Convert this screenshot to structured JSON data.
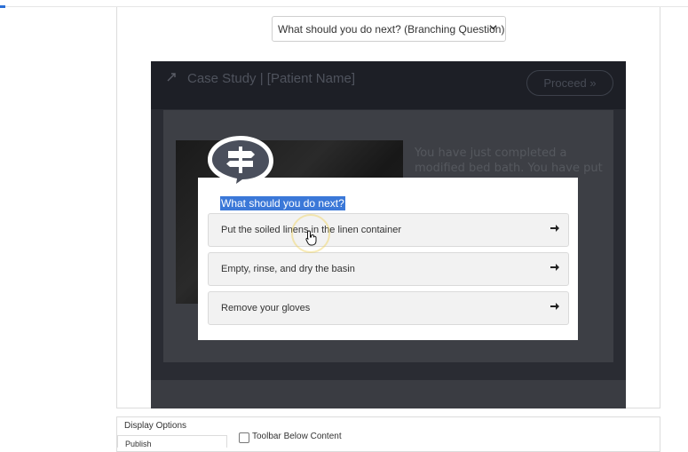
{
  "branching_select": {
    "value": "What should you do next? (Branching Question)"
  },
  "preview": {
    "title": "Case Study | [Patient Name]",
    "proceed_label": "Proceed »",
    "background_text": "You have just completed a modified bed bath.  You have put"
  },
  "question": {
    "prompt": "What should you do next?",
    "options": [
      {
        "label": "Put the soiled linens in the linen container"
      },
      {
        "label": "Empty, rinse, and dry the basin"
      },
      {
        "label": "Remove your gloves"
      }
    ]
  },
  "settings": {
    "display_options_label": "Display Options",
    "publish_label": "Publish",
    "toolbar_below_content_label": "Toolbar Below Content"
  },
  "icons": {
    "expand": "expand-icon",
    "signpost": "signpost-icon",
    "option_arrow": "arrow-right-icon",
    "select_chevron": "chevron-down-icon",
    "cursor": "pointer-hand-icon"
  },
  "colors": {
    "selection_highlight": "#3b78d8",
    "bubble": "#4a4f5c",
    "preview_bg": "#2a2c33"
  }
}
